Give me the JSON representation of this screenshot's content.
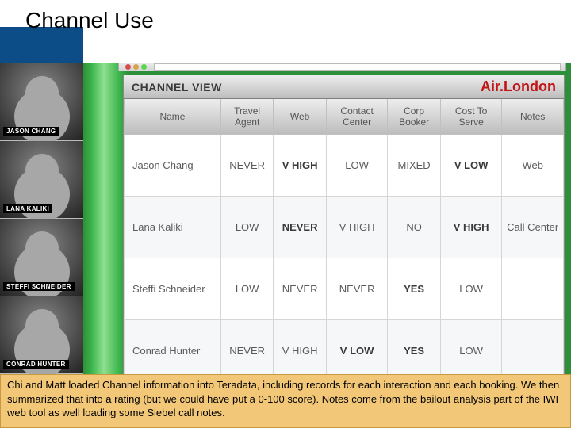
{
  "page_title": "Channel Use",
  "sidebar": {
    "people": [
      {
        "tag": "JASON CHANG"
      },
      {
        "tag": "LANA KALIKI"
      },
      {
        "tag": "STEFFI SCHNEIDER"
      },
      {
        "tag": "CONRAD HUNTER"
      }
    ]
  },
  "panel": {
    "title": "CHANNEL VIEW",
    "brand_a": "Air",
    "brand_b": "London"
  },
  "table": {
    "columns": [
      "Name",
      "Travel Agent",
      "Web",
      "Contact Center",
      "Corp Booker",
      "Cost To Serve",
      "Notes"
    ],
    "rows": [
      {
        "name": "Jason Chang",
        "cells": [
          "NEVER",
          "V HIGH",
          "LOW",
          "MIXED",
          "V LOW",
          "Web"
        ],
        "bold": [
          1,
          4
        ]
      },
      {
        "name": "Lana Kaliki",
        "cells": [
          "LOW",
          "NEVER",
          "V HIGH",
          "NO",
          "V HIGH",
          "Call Center"
        ],
        "bold": [
          1,
          4
        ]
      },
      {
        "name": "Steffi Schneider",
        "cells": [
          "LOW",
          "NEVER",
          "NEVER",
          "YES",
          "LOW",
          ""
        ],
        "bold": [
          3
        ]
      },
      {
        "name": "Conrad Hunter",
        "cells": [
          "NEVER",
          "V HIGH",
          "V LOW",
          "YES",
          "LOW",
          ""
        ],
        "bold": [
          2,
          3
        ]
      }
    ]
  },
  "footer": {
    "text": "Chi and Matt loaded Channel information into Teradata, including records for each interaction and each booking. We then summarized that into a rating (but we could have put a 0-100 score). Notes come from the bailout analysis part of the IWI web tool as well loading some Siebel call notes."
  }
}
